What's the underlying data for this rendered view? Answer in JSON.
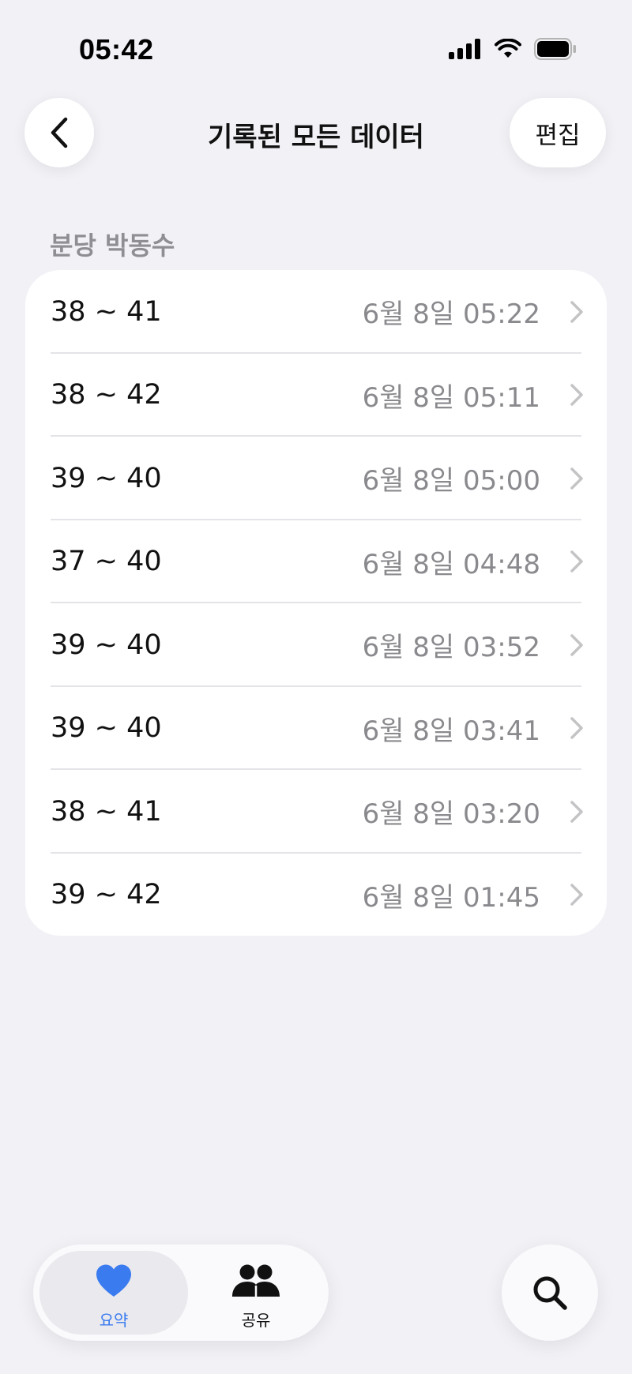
{
  "status_bar": {
    "time": "05:42",
    "icons": [
      "cellular-signal-icon",
      "wifi-icon",
      "battery-icon"
    ]
  },
  "nav": {
    "back_icon": "chevron-left-icon",
    "title": "기록된 모든 데이터",
    "edit_label": "편집"
  },
  "section": {
    "header": "분당 박동수"
  },
  "records": [
    {
      "range": "38 ~ 41",
      "date": "6월 8일 05:22"
    },
    {
      "range": "38 ~ 42",
      "date": "6월 8일 05:11"
    },
    {
      "range": "39 ~ 40",
      "date": "6월 8일 05:00"
    },
    {
      "range": "37 ~ 40",
      "date": "6월 8일 04:48"
    },
    {
      "range": "39 ~ 40",
      "date": "6월 8일 03:52"
    },
    {
      "range": "39 ~ 40",
      "date": "6월 8일 03:41"
    },
    {
      "range": "38 ~ 41",
      "date": "6월 8일 03:20"
    },
    {
      "range": "39 ~ 42",
      "date": "6월 8일 01:45"
    }
  ],
  "tab_bar": {
    "tabs": [
      {
        "label": "요약",
        "icon": "heart-icon",
        "selected": true
      },
      {
        "label": "공유",
        "icon": "people-icon",
        "selected": false
      }
    ],
    "search_icon": "search-icon"
  },
  "colors": {
    "accent": "#3a7bf0",
    "background": "#f1f1f6",
    "secondary_text": "#8a8a8e"
  }
}
